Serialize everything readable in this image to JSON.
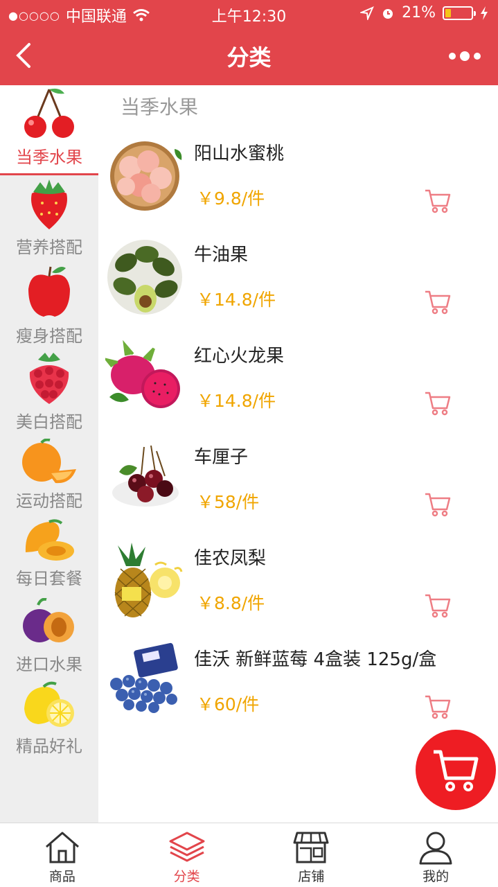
{
  "status_bar": {
    "carrier": "中国联通",
    "time": "上午12:30",
    "battery": "21%",
    "battery_level": 0.21
  },
  "nav": {
    "title": "分类",
    "back_icon": "chevron-left-icon",
    "more_icon": "more-dots-icon"
  },
  "sidebar": {
    "items": [
      {
        "label": "当季水果",
        "icon": "cherry-icon",
        "active": true
      },
      {
        "label": "营养搭配",
        "icon": "strawberry-icon"
      },
      {
        "label": "瘦身搭配",
        "icon": "apple-icon"
      },
      {
        "label": "美白搭配",
        "icon": "raspberry-icon"
      },
      {
        "label": "运动搭配",
        "icon": "orange-icon"
      },
      {
        "label": "每日套餐",
        "icon": "mango-icon"
      },
      {
        "label": "进口水果",
        "icon": "plum-icon"
      },
      {
        "label": "精品好礼",
        "icon": "lemon-icon"
      }
    ]
  },
  "main": {
    "section_title": "当季水果",
    "products": [
      {
        "name": "阳山水蜜桃",
        "price": "￥9.8/件"
      },
      {
        "name": "牛油果",
        "price": "￥14.8/件"
      },
      {
        "name": "红心火龙果",
        "price": "￥14.8/件"
      },
      {
        "name": "车厘子",
        "price": "￥58/件"
      },
      {
        "name": "佳农凤梨",
        "price": "￥8.8/件"
      },
      {
        "name": "佳沃 新鲜蓝莓 4盒装 125g/盒",
        "price": "￥60/件"
      }
    ]
  },
  "tabbar": {
    "items": [
      {
        "label": "商品",
        "icon": "home-icon"
      },
      {
        "label": "分类",
        "icon": "layers-icon",
        "active": true
      },
      {
        "label": "店铺",
        "icon": "store-icon"
      },
      {
        "label": "我的",
        "icon": "user-icon"
      }
    ]
  },
  "colors": {
    "brand": "#e2454b",
    "price": "#f0a500",
    "fab": "#ee1d23"
  }
}
